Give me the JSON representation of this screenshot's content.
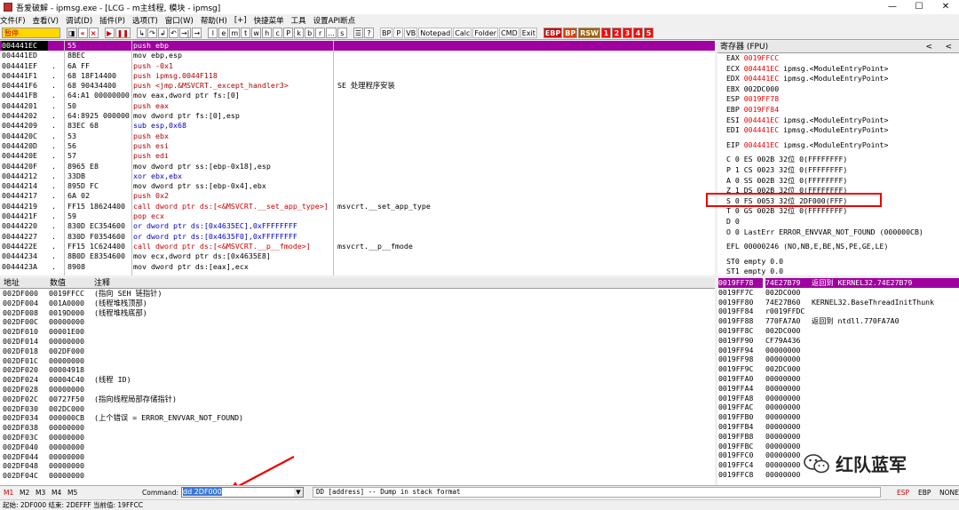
{
  "title": "吾爱破解 - ipmsg.exe - [LCG - m主线程, 模块 - ipmsg]",
  "menu": [
    "文件(F)",
    "查看(V)",
    "调试(D)",
    "插件(P)",
    "选项(T)",
    "窗口(W)",
    "帮助(H)",
    "[+]",
    "快捷菜单",
    "工具",
    "设置API断点"
  ],
  "toolbar": {
    "status": "暂停",
    "letters": [
      "l",
      "e",
      "m",
      "t",
      "w",
      "h",
      "c",
      "P",
      "k",
      "b",
      "r",
      "...",
      "s"
    ],
    "mid": [
      "BP",
      "P",
      "VB",
      "Notepad",
      "Calc",
      "Folder",
      "CMD",
      "Exit"
    ],
    "nums": [
      "1",
      "2",
      "3",
      "4",
      "5"
    ]
  },
  "disasm": [
    {
      "a": "004441EC",
      "m": "",
      "h": "55",
      "i": "push ebp",
      "c": "",
      "hl": true
    },
    {
      "a": "004441ED",
      "m": "",
      "h": "8BEC",
      "i": "mov ebp,esp",
      "c": ""
    },
    {
      "a": "004441EF",
      "m": ".",
      "h": "6A FF",
      "i": "push -0x1",
      "c": ""
    },
    {
      "a": "004441F1",
      "m": ".",
      "h": "68 18F14400",
      "i": "push ipmsg.0044F118",
      "c": ""
    },
    {
      "a": "004441F6",
      "m": ".",
      "h": "68 90434400",
      "i": "push <jmp.&MSVCRT._except_handler3>",
      "c": "SE 处理程序安装"
    },
    {
      "a": "004441FB",
      "m": ".",
      "h": "64:A1 00000000",
      "i": "mov eax,dword ptr fs:[0]",
      "c": ""
    },
    {
      "a": "00444201",
      "m": ".",
      "h": "50",
      "i": "push eax",
      "c": ""
    },
    {
      "a": "00444202",
      "m": ".",
      "h": "64:8925 00000000",
      "i": "mov dword ptr fs:[0],esp",
      "c": ""
    },
    {
      "a": "00444209",
      "m": ".",
      "h": "83EC 68",
      "i": "sub esp,0x68",
      "c": ""
    },
    {
      "a": "0044420C",
      "m": ".",
      "h": "53",
      "i": "push ebx",
      "c": ""
    },
    {
      "a": "0044420D",
      "m": ".",
      "h": "56",
      "i": "push esi",
      "c": ""
    },
    {
      "a": "0044420E",
      "m": ".",
      "h": "57",
      "i": "push edi",
      "c": ""
    },
    {
      "a": "0044420F",
      "m": ".",
      "h": "8965 E8",
      "i": "mov dword ptr ss:[ebp-0x18],esp",
      "c": ""
    },
    {
      "a": "00444212",
      "m": ".",
      "h": "33DB",
      "i": "xor ebx,ebx",
      "c": ""
    },
    {
      "a": "00444214",
      "m": ".",
      "h": "895D FC",
      "i": "mov dword ptr ss:[ebp-0x4],ebx",
      "c": ""
    },
    {
      "a": "00444217",
      "m": ".",
      "h": "6A 02",
      "i": "push 0x2",
      "c": ""
    },
    {
      "a": "00444219",
      "m": ".",
      "h": "FF15 18624400",
      "i": "call dword ptr ds:[<&MSVCRT.__set_app_type>]",
      "c": "msvcrt.__set_app_type"
    },
    {
      "a": "0044421F",
      "m": ".",
      "h": "59",
      "i": "pop ecx",
      "c": ""
    },
    {
      "a": "00444220",
      "m": ".",
      "h": "830D EC354600 FF",
      "i": "or dword ptr ds:[0x4635EC],0xFFFFFFFF",
      "c": ""
    },
    {
      "a": "00444227",
      "m": ".",
      "h": "830D F0354600 FF",
      "i": "or dword ptr ds:[0x4635F0],0xFFFFFFFF",
      "c": ""
    },
    {
      "a": "0044422E",
      "m": ".",
      "h": "FF15 1C624400",
      "i": "call dword ptr ds:[<&MSVCRT.__p__fmode>]",
      "c": "msvcrt.__p__fmode"
    },
    {
      "a": "00444234",
      "m": ".",
      "h": "8B0D E8354600",
      "i": "mov ecx,dword ptr ds:[0x4635E8]",
      "c": ""
    },
    {
      "a": "0044423A",
      "m": ".",
      "h": "8908",
      "i": "mov dword ptr ds:[eax],ecx",
      "c": ""
    }
  ],
  "regs": {
    "header": "寄存器 (FPU)",
    "lines": [
      {
        "n": "EAX",
        "v": "0019FFCC",
        "d": "",
        "red": true
      },
      {
        "n": "ECX",
        "v": "004441EC",
        "d": "ipmsg.<ModuleEntryPoint>",
        "red": true
      },
      {
        "n": "EDX",
        "v": "004441EC",
        "d": "ipmsg.<ModuleEntryPoint>",
        "red": true
      },
      {
        "n": "EBX",
        "v": "002DC000",
        "d": "",
        "red": false
      },
      {
        "n": "ESP",
        "v": "0019FF78",
        "d": "",
        "red": true
      },
      {
        "n": "EBP",
        "v": "0019FF84",
        "d": "",
        "red": true
      },
      {
        "n": "ESI",
        "v": "004441EC",
        "d": "ipmsg.<ModuleEntryPoint>",
        "red": true
      },
      {
        "n": "EDI",
        "v": "004441EC",
        "d": "ipmsg.<ModuleEntryPoint>",
        "red": true
      },
      {
        "sp": true
      },
      {
        "n": "EIP",
        "v": "004441EC",
        "d": "ipmsg.<ModuleEntryPoint>",
        "red": true
      },
      {
        "sp": true
      },
      {
        "n": "C 0",
        "v": "ES 002B",
        "d": "32位 0(FFFFFFFF)",
        "red": false
      },
      {
        "n": "P 1",
        "v": "CS 0023",
        "d": "32位 0(FFFFFFFF)",
        "red": false
      },
      {
        "n": "A 0",
        "v": "SS 002B",
        "d": "32位 0(FFFFFFFF)",
        "red": false
      },
      {
        "n": "Z 1",
        "v": "DS 002B",
        "d": "32位 0(FFFFFFFF)",
        "red": false
      },
      {
        "n": "S 0",
        "v": "FS 0053",
        "d": "32位 2DF000(FFF)",
        "red": false
      },
      {
        "n": "T 0",
        "v": "GS 002B",
        "d": "32位 0(FFFFFFFF)",
        "red": false
      },
      {
        "n": "D 0",
        "v": "",
        "d": "",
        "red": false
      },
      {
        "n": "O 0",
        "v": "LastErr",
        "d": "ERROR_ENVVAR_NOT_FOUND (000000CB)",
        "red": false
      },
      {
        "sp": true
      },
      {
        "n": "EFL",
        "v": "00000246",
        "d": "(NO,NB,E,BE,NS,PE,GE,LE)",
        "red": false
      },
      {
        "sp": true
      },
      {
        "n": "ST0",
        "v": "empty",
        "d": "0.0",
        "red": false
      },
      {
        "n": "ST1",
        "v": "empty",
        "d": "0.0",
        "red": false
      }
    ]
  },
  "dump": {
    "headers": [
      "地址",
      "数值",
      "注释"
    ],
    "rows": [
      {
        "a": "002DF000",
        "v": "0019FFCC",
        "n": "(指向 SEH 链指针)"
      },
      {
        "a": "002DF004",
        "v": "001A0000",
        "n": "(线程堆栈顶部)"
      },
      {
        "a": "002DF008",
        "v": "0019D000",
        "n": "(线程堆栈底部)"
      },
      {
        "a": "002DF00C",
        "v": "00000000",
        "n": ""
      },
      {
        "a": "002DF010",
        "v": "00001E00",
        "n": ""
      },
      {
        "a": "002DF014",
        "v": "00000000",
        "n": ""
      },
      {
        "a": "002DF018",
        "v": "002DF000",
        "n": ""
      },
      {
        "a": "002DF01C",
        "v": "00000000",
        "n": ""
      },
      {
        "a": "002DF020",
        "v": "00004918",
        "n": ""
      },
      {
        "a": "002DF024",
        "v": "00004C40",
        "n": "(线程 ID)"
      },
      {
        "a": "002DF028",
        "v": "00000000",
        "n": ""
      },
      {
        "a": "002DF02C",
        "v": "00727F50",
        "n": "(指向线程局部存储指针)"
      },
      {
        "a": "002DF030",
        "v": "002DC000",
        "n": ""
      },
      {
        "a": "002DF034",
        "v": "000000CB",
        "n": "(上个错误 = ERROR_ENVVAR_NOT_FOUND)"
      },
      {
        "a": "002DF038",
        "v": "00000000",
        "n": ""
      },
      {
        "a": "002DF03C",
        "v": "00000000",
        "n": ""
      },
      {
        "a": "002DF040",
        "v": "00000000",
        "n": ""
      },
      {
        "a": "002DF044",
        "v": "00000000",
        "n": ""
      },
      {
        "a": "002DF048",
        "v": "00000000",
        "n": ""
      },
      {
        "a": "002DF04C",
        "v": "00000000",
        "n": ""
      }
    ]
  },
  "stack": [
    {
      "a": "0019FF78",
      "v": "74E27B79",
      "n": "返回到 KERNEL32.74E27B79",
      "top": true
    },
    {
      "a": "0019FF7C",
      "v": "002DC000",
      "n": ""
    },
    {
      "a": "0019FF80",
      "v": "74E27B60",
      "n": "KERNEL32.BaseThreadInitThunk"
    },
    {
      "a": "0019FF84",
      "v": "r0019FFDC",
      "n": ""
    },
    {
      "a": "0019FF88",
      "v": "770FA7A0",
      "n": "返回到 ntdll.770FA7A0"
    },
    {
      "a": "0019FF8C",
      "v": "002DC000",
      "n": ""
    },
    {
      "a": "0019FF90",
      "v": "CF79A436",
      "n": ""
    },
    {
      "a": "0019FF94",
      "v": "00000000",
      "n": ""
    },
    {
      "a": "0019FF98",
      "v": "00000000",
      "n": ""
    },
    {
      "a": "0019FF9C",
      "v": "002DC000",
      "n": ""
    },
    {
      "a": "0019FFA0",
      "v": "00000000",
      "n": ""
    },
    {
      "a": "0019FFA4",
      "v": "00000000",
      "n": ""
    },
    {
      "a": "0019FFA8",
      "v": "00000000",
      "n": ""
    },
    {
      "a": "0019FFAC",
      "v": "00000000",
      "n": ""
    },
    {
      "a": "0019FFB0",
      "v": "00000000",
      "n": ""
    },
    {
      "a": "0019FFB4",
      "v": "00000000",
      "n": ""
    },
    {
      "a": "0019FFB8",
      "v": "00000000",
      "n": ""
    },
    {
      "a": "0019FFBC",
      "v": "00000000",
      "n": ""
    },
    {
      "a": "0019FFC0",
      "v": "00000000",
      "n": ""
    },
    {
      "a": "0019FFC4",
      "v": "00000000",
      "n": ""
    },
    {
      "a": "0019FFC8",
      "v": "00000000",
      "n": ""
    }
  ],
  "cmdbar": {
    "tabs": [
      "M1",
      "M2",
      "M3",
      "M4",
      "M5"
    ],
    "label": "Command:",
    "value": "dd 2DF000",
    "help": "DD [address] -- Dump in stack format",
    "right": [
      "ESP",
      "EBP",
      "NONE"
    ]
  },
  "status": "起始: 2DF000 结束: 2DEFFF 当前值: 19FFCC",
  "watermark": "红队蓝军",
  "colors": {
    "highlight": "#a000a0",
    "red": "#e00000",
    "status_bg": "#ffd800"
  }
}
